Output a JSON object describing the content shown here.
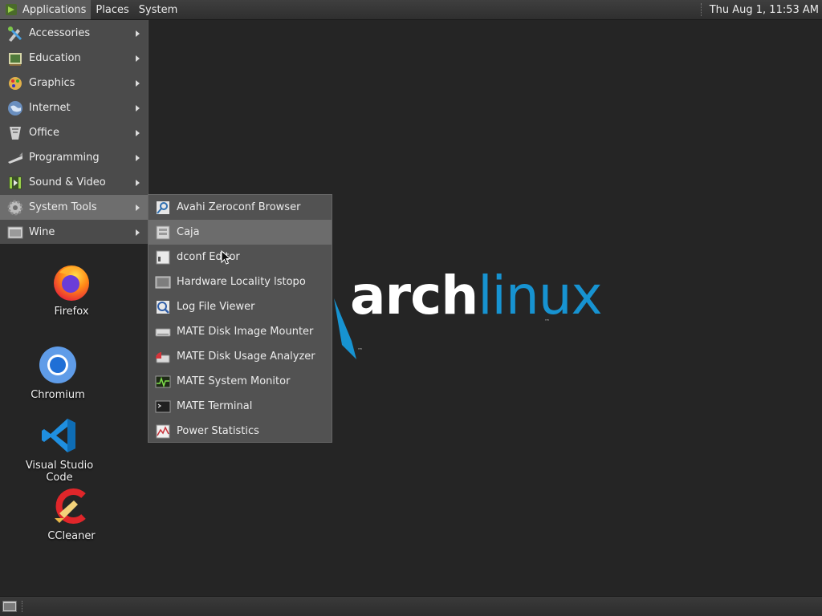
{
  "top_panel": {
    "menus": [
      "Applications",
      "Places",
      "System"
    ],
    "clock": "Thu Aug  1, 11:53 AM"
  },
  "app_menu": {
    "items": [
      {
        "label": "Accessories",
        "icon": "accessories-icon"
      },
      {
        "label": "Education",
        "icon": "education-icon"
      },
      {
        "label": "Graphics",
        "icon": "graphics-icon"
      },
      {
        "label": "Internet",
        "icon": "internet-icon"
      },
      {
        "label": "Office",
        "icon": "office-icon"
      },
      {
        "label": "Programming",
        "icon": "programming-icon"
      },
      {
        "label": "Sound & Video",
        "icon": "sound-video-icon"
      },
      {
        "label": "System Tools",
        "icon": "system-tools-icon"
      },
      {
        "label": "Wine",
        "icon": "wine-icon"
      }
    ],
    "active": "System Tools"
  },
  "system_tools_menu": {
    "items": [
      {
        "label": "Avahi Zeroconf Browser",
        "icon": "avahi-icon"
      },
      {
        "label": "Caja",
        "icon": "caja-icon"
      },
      {
        "label": "dconf Editor",
        "icon": "dconf-icon"
      },
      {
        "label": "Hardware Locality lstopo",
        "icon": "lstopo-icon"
      },
      {
        "label": "Log File Viewer",
        "icon": "log-viewer-icon"
      },
      {
        "label": "MATE Disk Image Mounter",
        "icon": "disk-mounter-icon"
      },
      {
        "label": "MATE Disk Usage Analyzer",
        "icon": "disk-usage-icon"
      },
      {
        "label": "MATE System Monitor",
        "icon": "system-monitor-icon"
      },
      {
        "label": "MATE Terminal",
        "icon": "terminal-icon"
      },
      {
        "label": "Power Statistics",
        "icon": "power-statistics-icon"
      }
    ],
    "hovered": "Caja"
  },
  "desktop": {
    "icons": [
      {
        "label": "Firefox",
        "icon": "firefox-icon"
      },
      {
        "label": "Chromium",
        "icon": "chromium-icon"
      },
      {
        "label": "Visual Studio Code",
        "icon": "vscode-icon"
      },
      {
        "label": "CCleaner",
        "icon": "ccleaner-icon"
      }
    ],
    "wallpaper": {
      "logo_arch": "arch",
      "logo_linux": "linux",
      "trademark": "™"
    }
  },
  "colors": {
    "desktop_bg": "#252525",
    "arch_blue": "#1793d1",
    "menu_bg": "#4e4e4e",
    "menu_active": "#6e6e6e"
  }
}
